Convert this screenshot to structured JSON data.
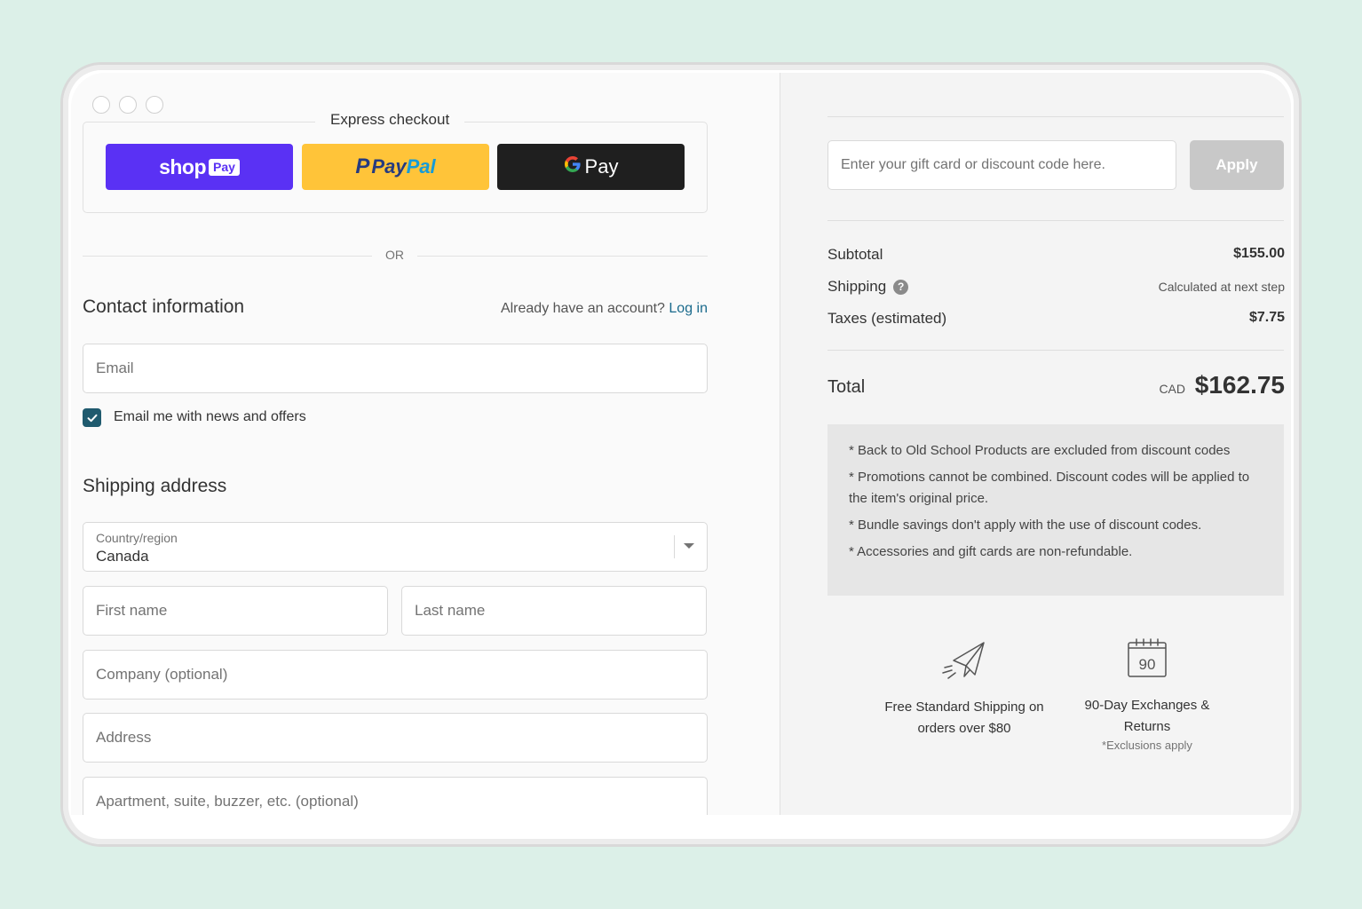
{
  "express": {
    "title": "Express checkout",
    "shop_pay": {
      "word": "shop",
      "pill": "Pay"
    },
    "paypal": {
      "p": "P",
      "pay": "Pay",
      "pal": "Pal"
    },
    "gpay": {
      "g": "G",
      "word": "Pay"
    },
    "or": "OR"
  },
  "contact": {
    "title": "Contact information",
    "account_prompt": "Already have an account?",
    "login": "Log in",
    "email_placeholder": "Email",
    "newsletter_label": "Email me with news and offers",
    "newsletter_checked": true
  },
  "shipping": {
    "title": "Shipping address",
    "country_label": "Country/region",
    "country_value": "Canada",
    "first_name": "First name",
    "last_name": "Last name",
    "company": "Company (optional)",
    "address": "Address",
    "apartment": "Apartment, suite, buzzer, etc. (optional)"
  },
  "summary": {
    "gift_placeholder": "Enter your gift card or discount code here.",
    "apply": "Apply",
    "subtotal_label": "Subtotal",
    "subtotal_value": "$155.00",
    "shipping_label": "Shipping",
    "shipping_value": "Calculated at next step",
    "taxes_label": "Taxes (estimated)",
    "taxes_value": "$7.75",
    "total_label": "Total",
    "currency": "CAD",
    "total_value": "$162.75"
  },
  "notes": [
    "* Back to Old School Products are excluded from discount codes",
    "* Promotions cannot be combined. Discount codes will be applied to the item's original price.",
    "* Bundle savings don't apply with the use of discount codes.",
    "* Accessories and gift cards are non-refundable."
  ],
  "perks": {
    "shipping_line1": "Free Standard Shipping on",
    "shipping_line2": "orders over $80",
    "returns_line1": "90-Day Exchanges &",
    "returns_line2": "Returns",
    "returns_note": "*Exclusions apply",
    "calendar_number": "90"
  },
  "colors": {
    "background": "#dcf0e8",
    "shop_pay": "#5a31f4",
    "paypal": "#ffc439",
    "gpay": "#1f1f1f",
    "checkbox": "#1f5a6e",
    "link": "#1a6a8c"
  }
}
